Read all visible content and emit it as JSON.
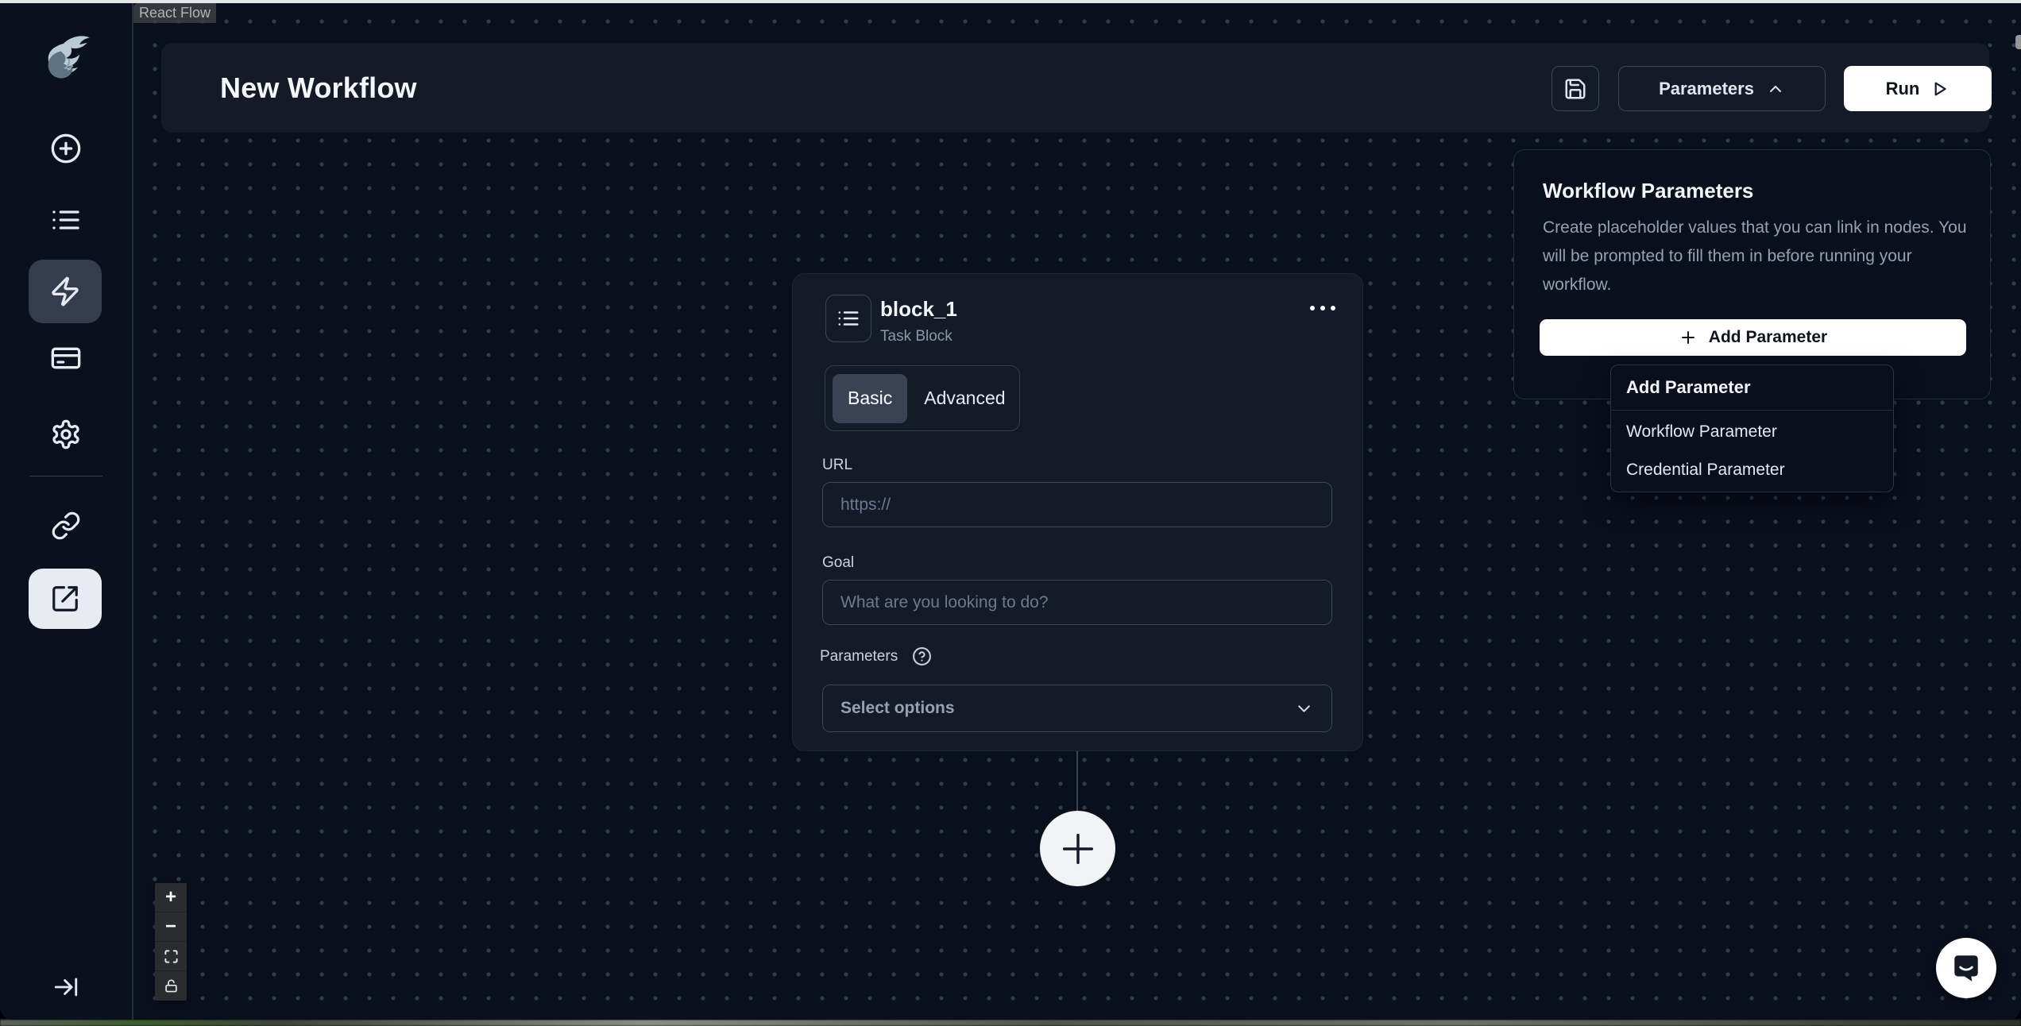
{
  "header": {
    "title": "New Workflow",
    "parameters_button": "Parameters",
    "run_button": "Run"
  },
  "sidebar": {
    "logo": "skyvern-dragon-logo",
    "items": [
      {
        "id": "create",
        "icon": "plus-circle-icon",
        "active": false
      },
      {
        "id": "runs",
        "icon": "list-icon",
        "active": false
      },
      {
        "id": "workflows",
        "icon": "zap-icon",
        "active": true
      },
      {
        "id": "billing",
        "icon": "credit-card-icon",
        "active": false
      },
      {
        "id": "settings",
        "icon": "gear-icon",
        "active": false
      },
      {
        "id": "integrations",
        "icon": "link-icon",
        "active": false
      },
      {
        "id": "external",
        "icon": "external-link-icon",
        "active": true
      }
    ]
  },
  "block": {
    "name": "block_1",
    "type_label": "Task Block",
    "tabs": {
      "basic": "Basic",
      "advanced": "Advanced"
    },
    "active_tab": "Basic",
    "url_label": "URL",
    "url_placeholder": "https://",
    "url_value": "",
    "goal_label": "Goal",
    "goal_placeholder": "What are you looking to do?",
    "goal_value": "",
    "parameters_label": "Parameters",
    "select_placeholder": "Select options"
  },
  "panel": {
    "title": "Workflow Parameters",
    "description": "Create placeholder values that you can link in nodes. You will be prompted to fill them in before running your workflow.",
    "add_button": "Add Parameter"
  },
  "add_menu": {
    "header": "Add Parameter",
    "items": [
      "Workflow Parameter",
      "Credential Parameter"
    ]
  },
  "controls": {
    "zoom_in": "+",
    "zoom_out": "−"
  },
  "attribution": "React Flow",
  "colors": {
    "canvas_bg": "#0a0f1d",
    "surface_bg": "#151a29",
    "active_slate": "#3a4254",
    "border": "#3d4556",
    "white": "#ffffff",
    "muted_text": "#96a0b2"
  }
}
